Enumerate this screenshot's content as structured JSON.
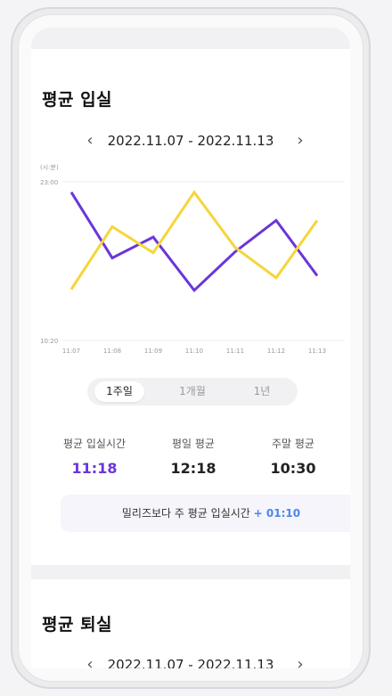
{
  "section1": {
    "title": "평균 입실",
    "date_range": "2022.11.07 - 2022.11.13",
    "prev_icon": "chevron-left-icon",
    "next_icon": "chevron-right-icon",
    "unit": "(시:분)",
    "tabs": [
      {
        "label": "1주일",
        "active": true
      },
      {
        "label": "1개월",
        "active": false
      },
      {
        "label": "1년",
        "active": false
      }
    ],
    "stats": [
      {
        "label": "평균 입실시간",
        "value": "11:18"
      },
      {
        "label": "평일 평균",
        "value": "12:18"
      },
      {
        "label": "주말 평균",
        "value": "10:30"
      }
    ],
    "compare_text": "밀리즈보다 주 평균 입실시간",
    "compare_diff": "+ 01:10"
  },
  "section2": {
    "title": "평균 퇴실",
    "date_range": "2022.11.07 - 2022.11.13"
  },
  "colors": {
    "purple": "#6a36d9",
    "yellow": "#f6d53b"
  },
  "chart_data": {
    "type": "line",
    "x": [
      "11:07",
      "11:08",
      "11:09",
      "11:10",
      "11:11",
      "11:12",
      "11:13"
    ],
    "y_ticks": [
      "23:00",
      "10:20"
    ],
    "ylim": [
      "10:20",
      "23:00"
    ],
    "ylabel": "(시:분)",
    "series": [
      {
        "color": "#6a36d9",
        "values": [
          "22:10",
          "16:55",
          "18:35",
          "14:20",
          "17:25",
          "19:55",
          "15:30"
        ]
      },
      {
        "color": "#f6d53b",
        "values": [
          "14:25",
          "19:25",
          "17:20",
          "22:10",
          "17:45",
          "15:20",
          "19:55"
        ]
      }
    ]
  }
}
